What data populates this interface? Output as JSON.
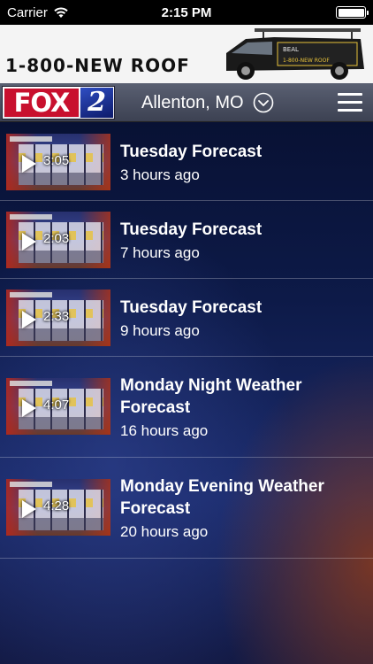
{
  "status": {
    "carrier": "Carrier",
    "time": "2:15 PM",
    "battery_percent": 100
  },
  "ad": {
    "phone": "1-800-NEW ROOF",
    "truck_sign_name": "BEAL",
    "truck_sign_phone": "1-800-NEW ROOF"
  },
  "nav": {
    "logo_text": "FOX",
    "logo_number": "2",
    "location": "Allenton, MO",
    "location_chevron_icon": "chevron-down-circle-icon",
    "menu_icon": "hamburger-menu-icon"
  },
  "videos": [
    {
      "title": "Tuesday Forecast",
      "age": "3 hours ago",
      "duration": "3:05"
    },
    {
      "title": "Tuesday Forecast",
      "age": "7 hours ago",
      "duration": "2:03"
    },
    {
      "title": "Tuesday Forecast",
      "age": "9 hours ago",
      "duration": "2:33"
    },
    {
      "title": "Monday Night Weather Forecast",
      "age": "16 hours ago",
      "duration": "4:07"
    },
    {
      "title": "Monday Evening Weather Forecast",
      "age": "20 hours ago",
      "duration": "4:28"
    }
  ]
}
